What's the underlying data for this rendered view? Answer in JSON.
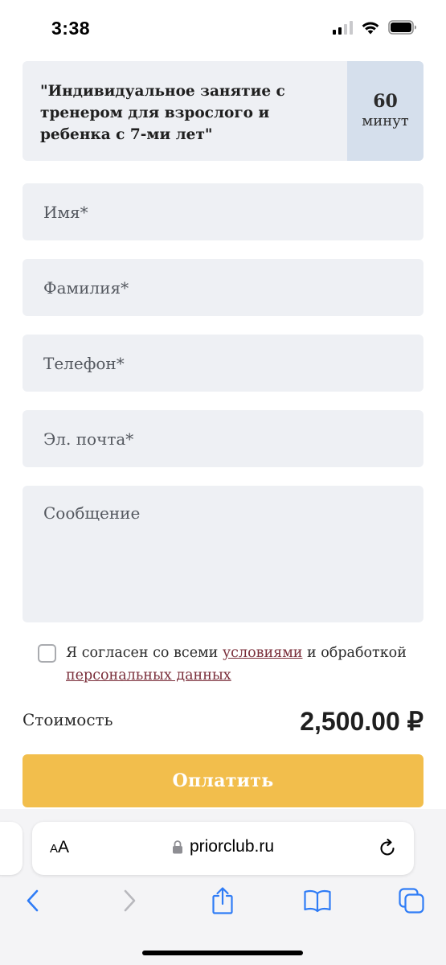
{
  "status_bar": {
    "time": "3:38",
    "icons": [
      "cellular-signal-icon",
      "wifi-icon",
      "battery-icon"
    ]
  },
  "product": {
    "title": "\"Индивидуальное занятие с тренером для взрослого и ребенка с 7-ми лет\"",
    "duration_value": "60",
    "duration_unit": "минут"
  },
  "form": {
    "first_name": {
      "value": "",
      "placeholder": "Имя*"
    },
    "last_name": {
      "value": "",
      "placeholder": "Фамилия*"
    },
    "phone": {
      "value": "",
      "placeholder": "Телефон*"
    },
    "email": {
      "value": "",
      "placeholder": "Эл. почта*"
    },
    "message": {
      "value": "",
      "placeholder": "Сообщение"
    },
    "consent": {
      "checked": false,
      "text_before": "Я согласен со всеми ",
      "link_terms": "условиями",
      "text_middle": " и обработкой ",
      "link_personal_data": "персональных данных"
    }
  },
  "cost": {
    "label": "Стоимость",
    "value": "2,500.00 ₽"
  },
  "pay_button": {
    "label": "Оплатить"
  },
  "browser": {
    "text_size_small": "A",
    "text_size_big": "A",
    "url": "priorclub.ru",
    "toolbar_icons": [
      "back-icon",
      "forward-icon",
      "share-icon",
      "bookmarks-icon",
      "tabs-icon"
    ]
  },
  "colors": {
    "accent_button": "#f2be4c",
    "field_background": "#eef0f4",
    "duration_background": "#d5dfec",
    "link": "#7a2e3a",
    "browser_blue": "#2f7cf6",
    "browser_disabled": "#b8b8bd"
  }
}
